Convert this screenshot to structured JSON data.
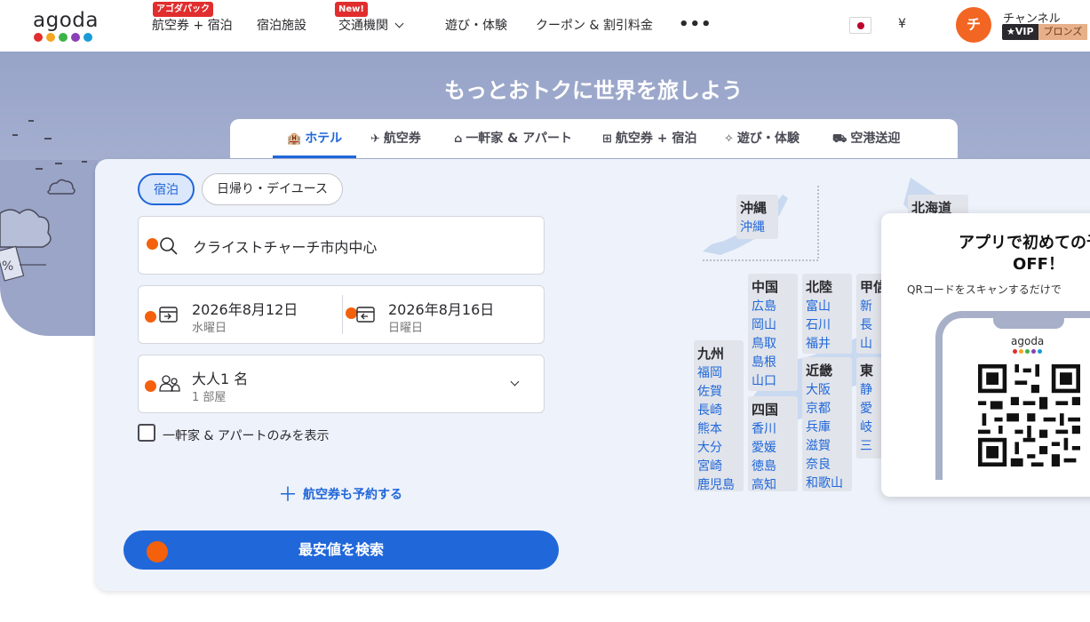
{
  "brand": {
    "name": "agoda",
    "dot_colors": [
      "#e12d2d",
      "#f5a623",
      "#3db34a",
      "#8a3fb6",
      "#1a9bd7"
    ]
  },
  "nav": {
    "items": [
      {
        "label": "航空券 + 宿泊",
        "badge": "アゴダパック"
      },
      {
        "label": "宿泊施設"
      },
      {
        "label": "交通機関",
        "badge": "New!"
      },
      {
        "label": "遊び・体験"
      },
      {
        "label": "クーポン & 割引料金"
      }
    ],
    "more": "•••",
    "currency": "¥",
    "user": {
      "initial": "チ",
      "name": "チャンネル",
      "vip": "★VIP",
      "tier": "ブロンズ"
    }
  },
  "hero": {
    "title": "もっとおトクに世界を旅しよう"
  },
  "tabs": [
    {
      "label": "ホテル",
      "icon": "hotel-icon"
    },
    {
      "label": "航空券",
      "icon": "plane-icon"
    },
    {
      "label": "一軒家 & アパート",
      "icon": "house-icon"
    },
    {
      "label": "航空券 + 宿泊",
      "icon": "package-icon"
    },
    {
      "label": "遊び・体験",
      "icon": "activity-icon"
    },
    {
      "label": "空港送迎",
      "icon": "car-icon"
    }
  ],
  "search": {
    "stay_types": [
      "宿泊",
      "日帰り・デイユース"
    ],
    "destination": "クライストチャーチ市内中心",
    "checkin": {
      "date": "2026年8月12日",
      "weekday": "水曜日"
    },
    "checkout": {
      "date": "2026年8月16日",
      "weekday": "日曜日"
    },
    "guests": {
      "main": "大人1 名",
      "rooms": "1 部屋"
    },
    "homes_only_label": "一軒家 & アパートのみを表示",
    "add_flight_label": "航空券も予約する",
    "submit_label": "最安値を検索"
  },
  "map": {
    "regions": [
      {
        "name": "沖縄",
        "prefs": [
          "沖縄"
        ]
      },
      {
        "name": "北海道",
        "prefs": []
      },
      {
        "name": "中国",
        "prefs": [
          "広島",
          "岡山",
          "鳥取",
          "島根",
          "山口"
        ]
      },
      {
        "name": "北陸",
        "prefs": [
          "富山",
          "石川",
          "福井"
        ]
      },
      {
        "name": "甲信",
        "prefs": [
          "新",
          "長",
          "山"
        ]
      },
      {
        "name": "九州",
        "prefs": [
          "福岡",
          "佐賀",
          "長崎",
          "熊本",
          "大分",
          "宮崎",
          "鹿児島"
        ]
      },
      {
        "name": "四国",
        "prefs": [
          "香川",
          "愛媛",
          "徳島",
          "高知"
        ]
      },
      {
        "name": "近畿",
        "prefs": [
          "大阪",
          "京都",
          "兵庫",
          "滋賀",
          "奈良",
          "和歌山"
        ]
      },
      {
        "name": "東",
        "prefs": [
          "静",
          "愛",
          "岐",
          "三"
        ]
      }
    ]
  },
  "app_promo": {
    "title_line1": "アプリで初めての予約",
    "title_line2": "OFF！",
    "subtitle": "QRコードをスキャンするだけで"
  }
}
